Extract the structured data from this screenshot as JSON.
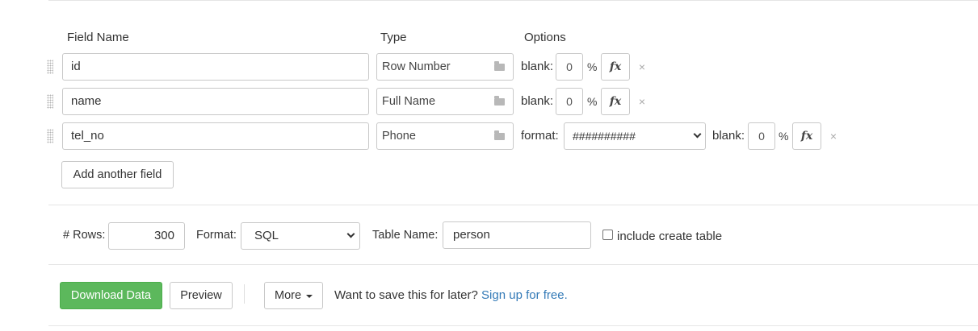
{
  "columns": {
    "field_name": "Field Name",
    "type": "Type",
    "options": "Options"
  },
  "fields": [
    {
      "name": "id",
      "type": "Row Number",
      "blank_label": "blank:",
      "blank_value": "0",
      "percent": "%",
      "fx": "fx",
      "remove": "×"
    },
    {
      "name": "name",
      "type": "Full Name",
      "blank_label": "blank:",
      "blank_value": "0",
      "percent": "%",
      "fx": "fx",
      "remove": "×"
    },
    {
      "name": "tel_no",
      "type": "Phone",
      "format_label": "format:",
      "format_value": "##########",
      "blank_label": "blank:",
      "blank_value": "0",
      "percent": "%",
      "fx": "fx",
      "remove": "×"
    }
  ],
  "add_field_button": "Add another field",
  "settings": {
    "rows_label": "# Rows:",
    "rows_value": "300",
    "format_label": "Format:",
    "format_value": "SQL",
    "table_name_label": "Table Name:",
    "table_name_value": "person",
    "include_create_table_label": "include create table",
    "include_create_table_checked": false
  },
  "actions": {
    "download": "Download Data",
    "preview": "Preview",
    "more": "More",
    "save_prompt": "Want to save this for later?",
    "signup_link": "Sign up for free."
  },
  "colors": {
    "primary_button": "#5cb85c",
    "link": "#337ab7",
    "border": "#c8c8c8"
  },
  "icons": {
    "drag": "drag-handle-icon",
    "type_picker": "folder-open-icon",
    "remove": "close-icon",
    "dropdown": "chevron-down-icon",
    "more_caret": "caret-down-icon"
  }
}
